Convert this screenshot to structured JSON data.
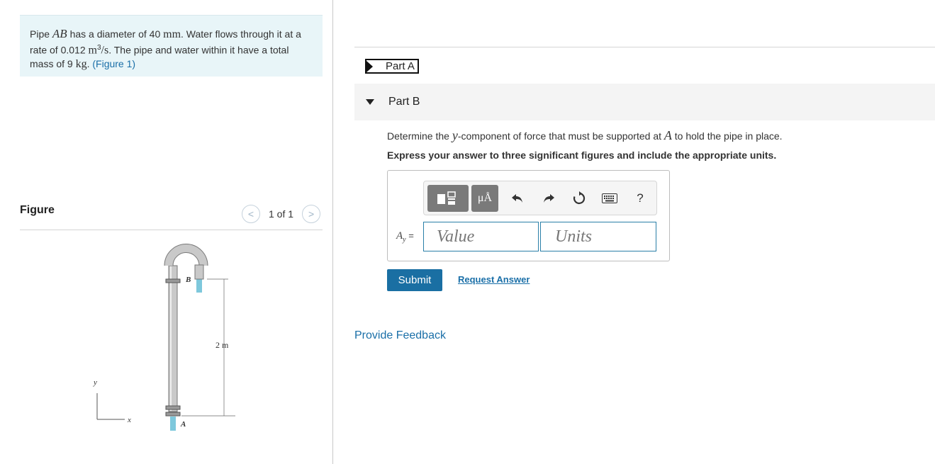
{
  "problem": {
    "text_1": "Pipe ",
    "var_ab": "AB",
    "text_2": " has a diameter of 40 ",
    "unit_mm": "mm",
    "text_3": ". Water flows through it at a rate of 0.012 ",
    "unit_m": "m",
    "sup_3": "3",
    "unit_s": "/s",
    "text_4": ". The pipe and water within it have a total mass of 9 ",
    "unit_kg": "kg",
    "text_5": ". ",
    "figure_link": "(Figure 1)"
  },
  "figure": {
    "title": "Figure",
    "pager_prev": "<",
    "pager_text": "1 of 1",
    "pager_next": ">",
    "label_b": "B",
    "label_a": "A",
    "label_length": "2 m",
    "label_y": "y",
    "label_x": "x"
  },
  "parts": {
    "part_a_label": "Part A",
    "part_b_label": "Part B"
  },
  "question": {
    "text_1": "Determine the ",
    "var_y": "y",
    "text_2": "-component of force that must be supported at ",
    "var_a": "A",
    "text_3": " to hold the pipe in place.",
    "instruction": "Express your answer to three significant figures and include the appropriate units."
  },
  "answer": {
    "label": "A",
    "label_sub": "y",
    "label_eq": " =",
    "value_placeholder": "Value",
    "units_placeholder": "Units"
  },
  "toolbar": {
    "units_symbol": "μÅ",
    "help": "?"
  },
  "actions": {
    "submit": "Submit",
    "request_answer": "Request Answer",
    "provide_feedback": "Provide Feedback"
  },
  "icons": {
    "template": "template-icon",
    "units": "mu-angstrom-icon",
    "undo": "undo-icon",
    "redo": "redo-icon",
    "reset": "reset-icon",
    "keyboard": "keyboard-icon",
    "help": "help-icon"
  }
}
